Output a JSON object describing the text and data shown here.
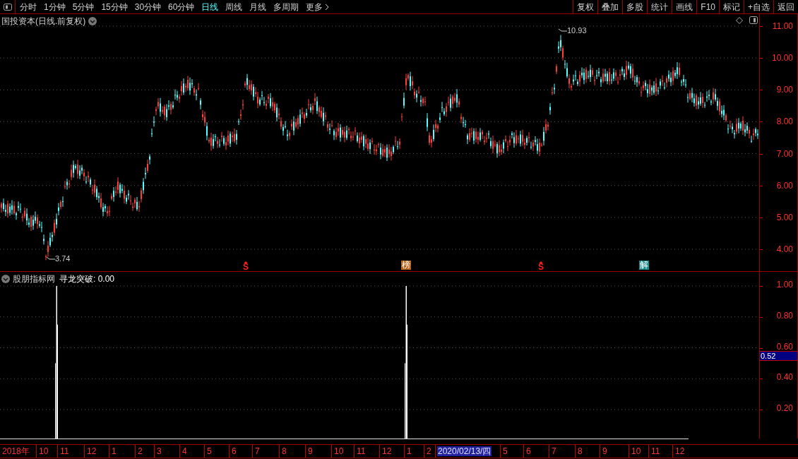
{
  "toolbar": {
    "periods": [
      {
        "label": "分时",
        "selected": false
      },
      {
        "label": "1分钟",
        "selected": false
      },
      {
        "label": "5分钟",
        "selected": false
      },
      {
        "label": "15分钟",
        "selected": false
      },
      {
        "label": "30分钟",
        "selected": false
      },
      {
        "label": "60分钟",
        "selected": false
      },
      {
        "label": "日线",
        "selected": true
      },
      {
        "label": "周线",
        "selected": false
      },
      {
        "label": "月线",
        "selected": false
      },
      {
        "label": "多周期",
        "selected": false
      },
      {
        "label": "更多",
        "selected": false
      }
    ],
    "buttons": [
      "复权",
      "叠加",
      "多股",
      "统计",
      "画线",
      "F10",
      "标记",
      "+自选",
      "返回"
    ]
  },
  "chart": {
    "title": "国投资本(日线.前复权)",
    "price_axis": [
      "11.00",
      "10.00",
      "9.00",
      "8.00",
      "7.00",
      "6.00",
      "5.00",
      "4.00"
    ],
    "high_label": "10.93",
    "low_label": "3.74",
    "signals": [
      {
        "kind": "arrow_s",
        "text": "S"
      },
      {
        "kind": "badge",
        "text": "榜",
        "color": "#b8651b"
      },
      {
        "kind": "arrow_s",
        "text": "S"
      },
      {
        "kind": "badge",
        "text": "解",
        "color": "#1a8a8a"
      }
    ]
  },
  "indicator": {
    "source": "股朋指标网",
    "reading": "寻龙突破: 0.00",
    "axis": [
      "1.00",
      "0.80",
      "0.60",
      "0.40",
      "0.20"
    ],
    "current_value": "0.52"
  },
  "date_axis": [
    {
      "text": "2018年",
      "selected": false
    },
    {
      "text": "10",
      "selected": false
    },
    {
      "text": "11",
      "selected": false
    },
    {
      "text": "12",
      "selected": false
    },
    {
      "text": "1",
      "selected": false
    },
    {
      "text": "2",
      "selected": false
    },
    {
      "text": "3",
      "selected": false
    },
    {
      "text": "4",
      "selected": false
    },
    {
      "text": "5",
      "selected": false
    },
    {
      "text": "6",
      "selected": false
    },
    {
      "text": "7",
      "selected": false
    },
    {
      "text": "8",
      "selected": false
    },
    {
      "text": "9",
      "selected": false
    },
    {
      "text": "10",
      "selected": false
    },
    {
      "text": "11",
      "selected": false
    },
    {
      "text": "12",
      "selected": false
    },
    {
      "text": "1",
      "selected": false
    },
    {
      "text": "2",
      "selected": false
    },
    {
      "text": "2020/02/13/四",
      "selected": true
    },
    {
      "text": "5",
      "selected": false
    },
    {
      "text": "6",
      "selected": false
    },
    {
      "text": "7",
      "selected": false
    },
    {
      "text": "8",
      "selected": false
    },
    {
      "text": "9",
      "selected": false
    },
    {
      "text": "10",
      "selected": false
    },
    {
      "text": "11",
      "selected": false
    },
    {
      "text": "12",
      "selected": false
    }
  ]
}
